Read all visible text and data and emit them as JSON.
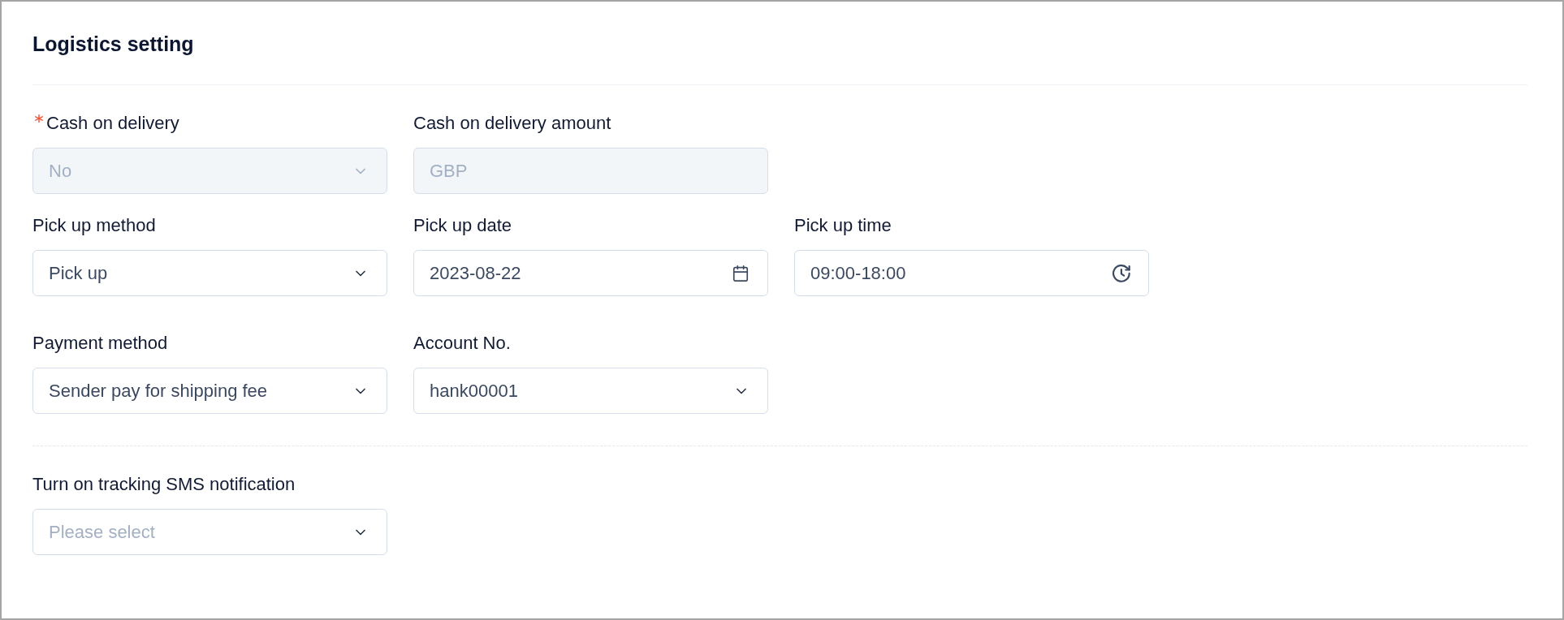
{
  "title": "Logistics setting",
  "sections": [
    {
      "rows": [
        [
          {
            "kind": "select",
            "label": "Cash on delivery",
            "required": true,
            "disabled": true,
            "value": "No"
          },
          {
            "kind": "text",
            "label": "Cash on delivery amount",
            "required": false,
            "disabled": true,
            "placeholder": "GBP"
          }
        ],
        [
          {
            "kind": "select",
            "label": "Pick up method",
            "required": false,
            "disabled": false,
            "value": "Pick up"
          },
          {
            "kind": "date",
            "label": "Pick up date",
            "required": false,
            "disabled": false,
            "value": "2023-08-22"
          },
          {
            "kind": "time",
            "label": "Pick up time",
            "required": false,
            "disabled": false,
            "value": "09:00-18:00"
          }
        ],
        [
          {
            "kind": "select",
            "label": "Payment method",
            "required": false,
            "disabled": false,
            "value": "Sender pay for shipping fee"
          },
          {
            "kind": "select",
            "label": "Account No.",
            "required": false,
            "disabled": false,
            "value": "hank00001"
          }
        ]
      ]
    },
    {
      "rows": [
        [
          {
            "kind": "select",
            "label": "Turn on tracking SMS notification",
            "required": false,
            "disabled": false,
            "placeholder": "Please select"
          }
        ]
      ]
    }
  ]
}
